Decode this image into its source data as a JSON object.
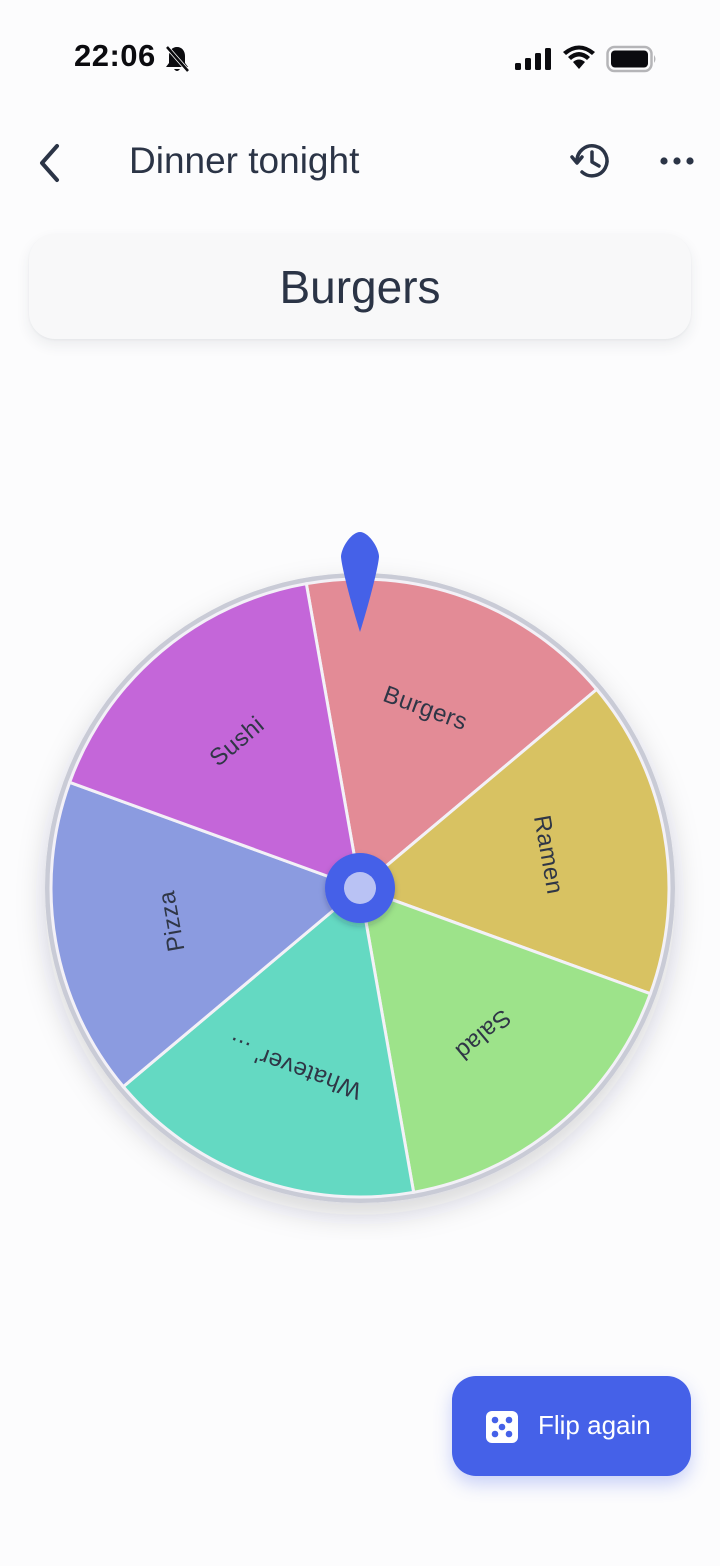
{
  "status_bar": {
    "time": "22:06",
    "icons": [
      "bell-slash-icon",
      "cellular-signal-icon",
      "wifi-icon",
      "battery-icon"
    ]
  },
  "header": {
    "title": "Dinner tonight",
    "back_icon": "chevron-left-icon",
    "history_icon": "history-icon",
    "more_icon": "ellipsis-icon"
  },
  "result": {
    "value": "Burgers"
  },
  "wheel": {
    "selected": "Burgers",
    "segments": [
      {
        "label": "Burgers",
        "color": "#e38b96"
      },
      {
        "label": "Ramen",
        "color": "#d8c262"
      },
      {
        "label": "Salad",
        "color": "#9de38a"
      },
      {
        "label": "Whatever' ...",
        "color": "#64d9c2"
      },
      {
        "label": "Pizza",
        "color": "#8b9be0"
      },
      {
        "label": "Sushi",
        "color": "#c466d9"
      }
    ],
    "rim_color": "#c9cbd6",
    "hub_color": "#4561e8",
    "pointer_color": "#4561e8"
  },
  "actions": {
    "flip_again_label": "Flip again",
    "flip_icon": "dice-icon",
    "accent": "#4561e8"
  }
}
